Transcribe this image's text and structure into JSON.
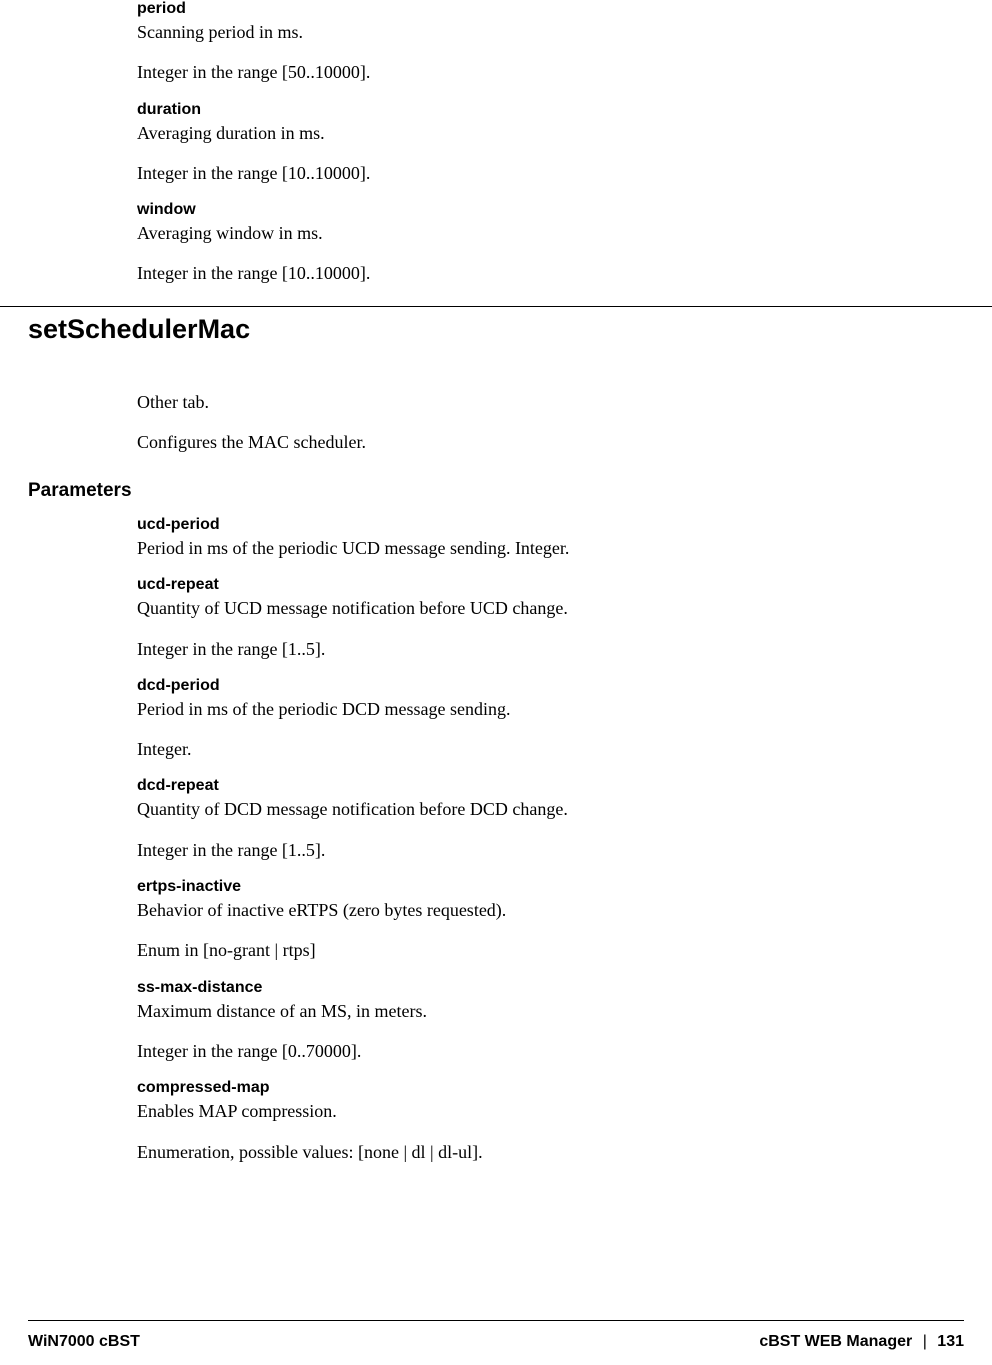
{
  "top_params": [
    {
      "name": "period",
      "desc": "Scanning period in ms.",
      "range": "Integer in the range [50..10000]."
    },
    {
      "name": "duration",
      "desc": "Averaging duration in ms.",
      "range": "Integer in the range [10..10000]."
    },
    {
      "name": "window",
      "desc": "Averaging window in ms.",
      "range": "Integer in the range [10..10000]."
    }
  ],
  "section_heading": "setSchedulerMac",
  "section_intro": [
    "Other tab.",
    "Configures the MAC scheduler."
  ],
  "parameters_label": "Parameters",
  "parameters": [
    {
      "name": "ucd-period",
      "lines": [
        "Period in ms of the periodic UCD message sending. Integer."
      ]
    },
    {
      "name": "ucd-repeat",
      "lines": [
        "Quantity of UCD message notification before UCD change.",
        "Integer in the range [1..5]."
      ]
    },
    {
      "name": "dcd-period",
      "lines": [
        "Period in ms of the periodic DCD message sending.",
        "Integer."
      ]
    },
    {
      "name": "dcd-repeat",
      "lines": [
        "Quantity of DCD message notification before DCD change.",
        "Integer in the range [1..5]."
      ]
    },
    {
      "name": "ertps-inactive",
      "lines": [
        "Behavior of inactive eRTPS (zero bytes requested).",
        "Enum in [no-grant | rtps]"
      ]
    },
    {
      "name": "ss-max-distance",
      "lines": [
        "Maximum distance of an MS, in meters.",
        "Integer in the range [0..70000]."
      ]
    },
    {
      "name": "compressed-map",
      "lines": [
        "Enables MAP compression.",
        "Enumeration, possible values: [none | dl | dl-ul]."
      ]
    }
  ],
  "footer": {
    "left": "WiN7000 cBST",
    "right_title": "cBST WEB Manager",
    "separator": "|",
    "page": "131"
  }
}
